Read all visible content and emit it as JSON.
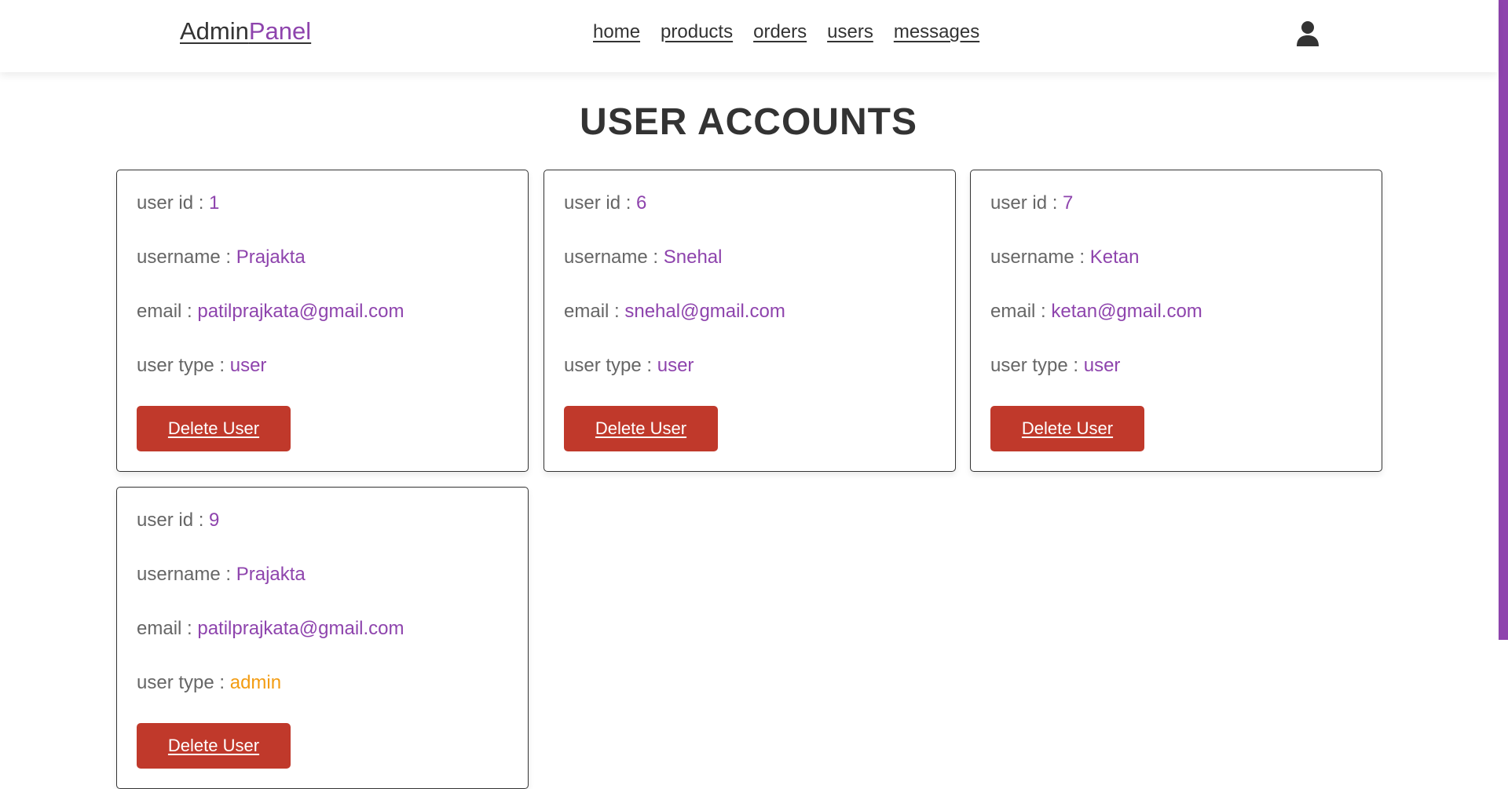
{
  "header": {
    "logo_main": "Admin",
    "logo_accent": "Panel",
    "nav": [
      "home",
      "products",
      "orders",
      "users",
      "messages"
    ],
    "profile_icon": "user-icon"
  },
  "page_title": "USER ACCOUNTS",
  "labels": {
    "user_id": "user id : ",
    "username": "username : ",
    "email": "email : ",
    "user_type": "user type : ",
    "delete": "Delete User"
  },
  "users": [
    {
      "id": "1",
      "username": "Prajakta",
      "email": "patilprajkata@gmail.com",
      "type": "user"
    },
    {
      "id": "6",
      "username": "Snehal",
      "email": "snehal@gmail.com",
      "type": "user"
    },
    {
      "id": "7",
      "username": "Ketan",
      "email": "ketan@gmail.com",
      "type": "user"
    },
    {
      "id": "9",
      "username": "Prajakta",
      "email": "patilprajkata@gmail.com",
      "type": "admin"
    }
  ],
  "colors": {
    "accent": "#8e44ad",
    "admin": "#f39c12",
    "delete": "#c0392b",
    "text": "#333333",
    "label": "#666666"
  }
}
